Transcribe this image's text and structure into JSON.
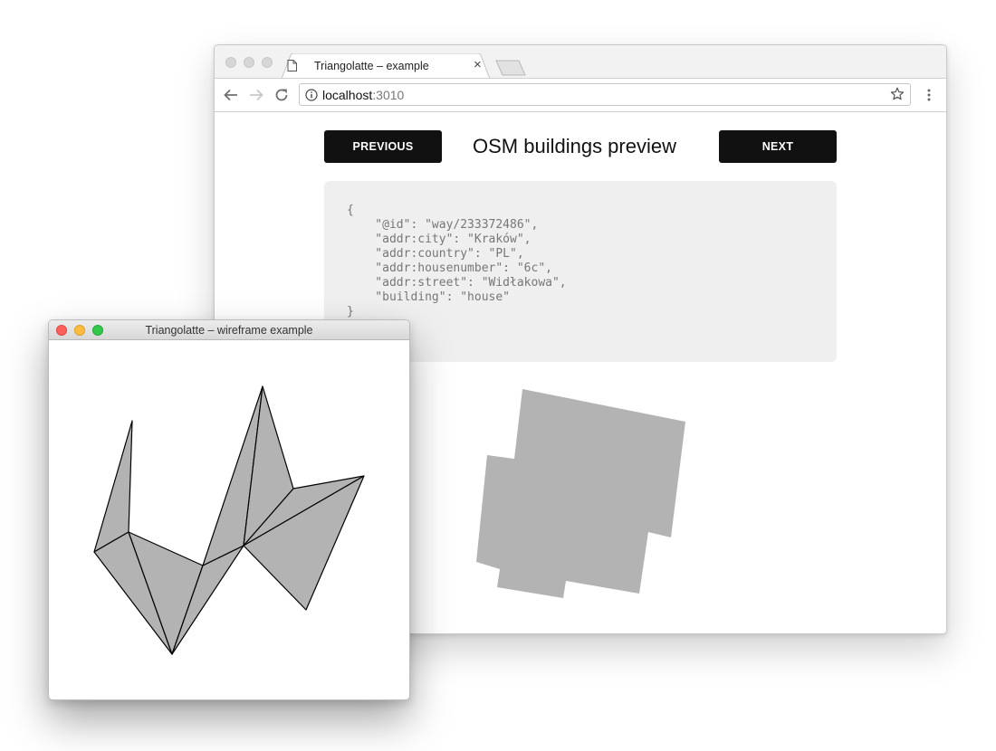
{
  "browser": {
    "tab_title": "Triangolatte – example",
    "close_glyph": "×",
    "url_host": "localhost",
    "url_port": ":3010"
  },
  "page": {
    "previous_label": "PREVIOUS",
    "next_label": "NEXT",
    "title": "OSM buildings preview",
    "json_text": "{\n    \"@id\": \"way/233372486\",\n    \"addr:city\": \"Kraków\",\n    \"addr:country\": \"PL\",\n    \"addr:housenumber\": \"6c\",\n    \"addr:street\": \"Widłakowa\",\n    \"building\": \"house\"\n}"
  },
  "wireframe_window": {
    "title": "Triangolatte – wireframe example"
  },
  "icons": {
    "back": "arrow-left-icon",
    "forward": "arrow-right-icon",
    "reload": "reload-icon",
    "info": "info-icon",
    "bookmark": "star-icon",
    "menu": "kebab-menu-icon",
    "tab_page": "document-icon"
  },
  "colors": {
    "shape_fill": "#b3b3b3",
    "button_bg": "#111111",
    "json_bg": "#efefef",
    "traffic_red": "#fc605c",
    "traffic_yellow": "#fdbc40",
    "traffic_green": "#34c84a"
  }
}
